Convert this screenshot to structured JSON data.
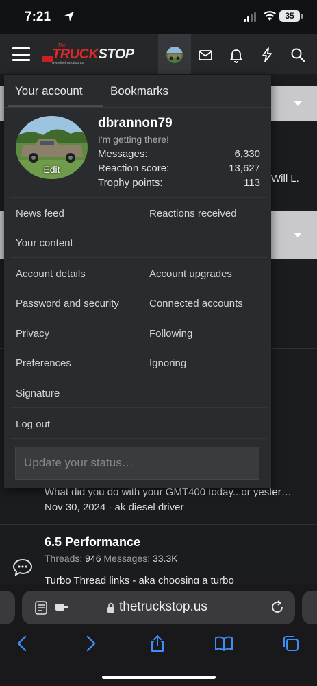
{
  "status_bar": {
    "time": "7:21",
    "battery": "35"
  },
  "site": {
    "logo_the": "The",
    "logo_truck": "TRUCK",
    "logo_stop": "STOP",
    "logo_url": "www.thetruckstop.us",
    "brand_color": "#e12828"
  },
  "header_icons": [
    "menu-icon",
    "avatar",
    "mail-icon",
    "bell-icon",
    "lightning-icon",
    "search-icon"
  ],
  "background": {
    "partial_name": "Will L.",
    "latest_thread_1": "What did you do with your GMT400 today...or yester…",
    "latest_meta_1": "Nov 30, 2024 · ak diesel driver",
    "forum_2": {
      "title": "6.5 Performance",
      "threads_label": "Threads:",
      "threads": "946",
      "messages_label": "Messages:",
      "messages": "33.3K",
      "latest": "Turbo Thread links - aka choosing a turbo"
    }
  },
  "menu": {
    "tabs": [
      {
        "label": "Your account",
        "active": true
      },
      {
        "label": "Bookmarks",
        "active": false
      }
    ],
    "profile": {
      "username": "dbrannon79",
      "user_title": "I'm getting there!",
      "avatar_edit_label": "Edit",
      "stats": [
        {
          "label": "Messages:",
          "value": "6,330"
        },
        {
          "label": "Reaction score:",
          "value": "13,627"
        },
        {
          "label": "Trophy points:",
          "value": "113"
        }
      ]
    },
    "links": {
      "news_feed": "News feed",
      "reactions_received": "Reactions received",
      "your_content": "Your content",
      "account_details": "Account details",
      "account_upgrades": "Account upgrades",
      "password_security": "Password and security",
      "connected_accounts": "Connected accounts",
      "privacy": "Privacy",
      "following": "Following",
      "preferences": "Preferences",
      "ignoring": "Ignoring",
      "signature": "Signature",
      "log_out": "Log out"
    },
    "status_placeholder": "Update your status…"
  },
  "safari": {
    "url": "thetruckstop.us",
    "nav_icons": [
      "back-icon",
      "forward-icon",
      "share-icon",
      "bookmarks-icon",
      "tabs-icon"
    ]
  }
}
